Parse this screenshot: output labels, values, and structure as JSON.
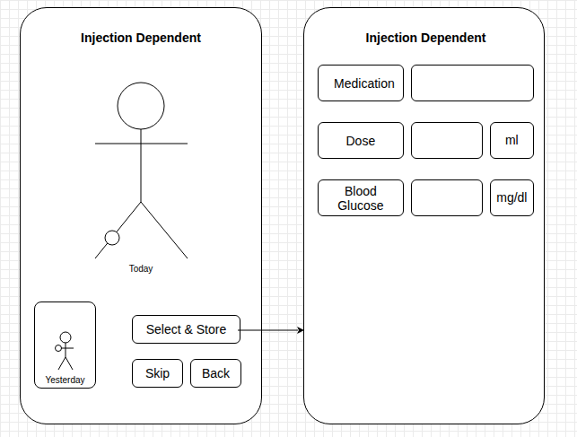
{
  "left_screen": {
    "title": "Injection Dependent",
    "today_label": "Today",
    "yesterday_label": "Yesterday",
    "buttons": [
      "Select & Store",
      "Skip",
      "Back"
    ]
  },
  "right_screen": {
    "title": "Injection Dependent",
    "fields": [
      {
        "label": "Medication",
        "value": ""
      },
      {
        "label": "Dose",
        "value": "",
        "unit": "ml"
      },
      {
        "label": "Blood Glucose",
        "value": "",
        "unit": "mg/dl"
      }
    ]
  }
}
